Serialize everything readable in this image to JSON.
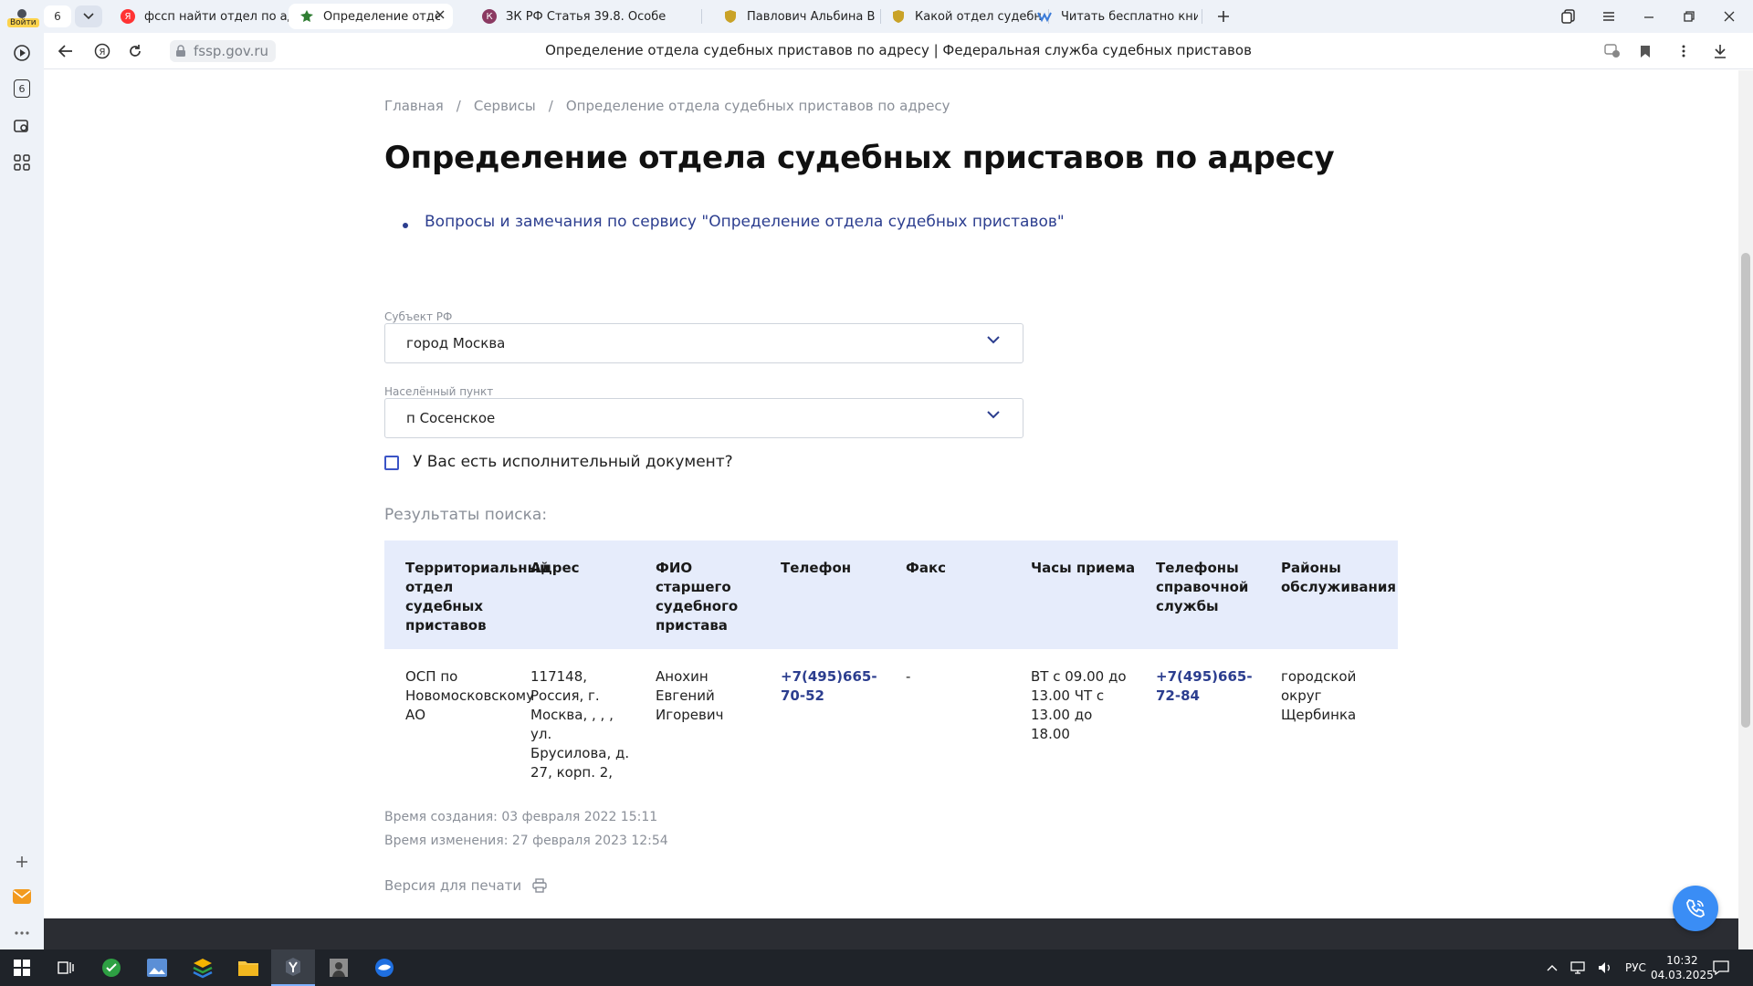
{
  "browser": {
    "sidebar": {
      "login_label": "Войти",
      "badge_count": "6"
    },
    "tabs": {
      "count": "6",
      "items": [
        {
          "title": "фссп найти отдел по адре",
          "icon": "yandex-icon",
          "color": "#f33"
        },
        {
          "title": "Определение отдела с",
          "icon": "fssp-emblem-icon",
          "color": "#2f7d32",
          "active": true
        },
        {
          "title": "ЗК РФ Статья 39.8. Особе",
          "icon": "consultant-icon",
          "color": "#8b3a62"
        },
        {
          "title": "Павлович Альбина Васил",
          "icon": "shield-icon",
          "color": "#c9a227"
        },
        {
          "title": "Какой отдел судебных пр",
          "icon": "shield-icon",
          "color": "#c9a227"
        },
        {
          "title": "Читать бесплатно книгу ",
          "icon": "book-icon",
          "color": "#3b7bd8"
        }
      ]
    },
    "address": {
      "domain": "fssp.gov.ru",
      "page_title": "Определение отдела судебных приставов по адресу | Федеральная служба судебных приставов"
    }
  },
  "page": {
    "breadcrumbs": [
      "Главная",
      "Сервисы",
      "Определение отдела судебных приставов по адресу"
    ],
    "breadcrumb_sep": "/",
    "title": "Определение отдела судебных приставов по адресу",
    "feedback_link": "Вопросы и замечания по сервису \"Определение отдела судебных приставов\"",
    "form": {
      "subject_label": "Субъект РФ",
      "subject_value": "город Москва",
      "locality_label": "Населённый пункт",
      "locality_value": "п Сосенское",
      "has_document_label": "У Вас есть исполнительный документ?",
      "has_document_checked": false
    },
    "results_label": "Результаты поиска:",
    "table": {
      "headers": [
        "Территориальный отдел судебных приставов",
        "Адрес",
        "ФИО старшего судебного пристава",
        "Телефон",
        "Факс",
        "Часы приема",
        "Телефоны справочной службы",
        "Районы обслуживания"
      ],
      "rows": [
        [
          "ОСП по Новомосковскому АО",
          "117148, Россия, г. Москва, , , , ул. Брусилова, д. 27, корп. 2,",
          "Анохин Евгений Игоревич",
          "+7(495)665-70-52",
          "-",
          "ВТ с 09.00 до 13.00 ЧТ с 13.00 до 18.00",
          "+7(495)665-72-84",
          "городской округ Щербинка"
        ]
      ]
    },
    "created": "Время создания: 03 февраля 2022 15:11",
    "modified": "Время изменения: 27 февраля 2023 12:54",
    "print_label": "Версия для печати"
  },
  "taskbar": {
    "lang": "РУС",
    "time": "10:32",
    "date": "04.03.2025"
  },
  "colors": {
    "link": "#2c3e8f",
    "table_header_bg": "#e6ecfb",
    "footer": "#2b2d33",
    "fab": "#3a8df5"
  }
}
